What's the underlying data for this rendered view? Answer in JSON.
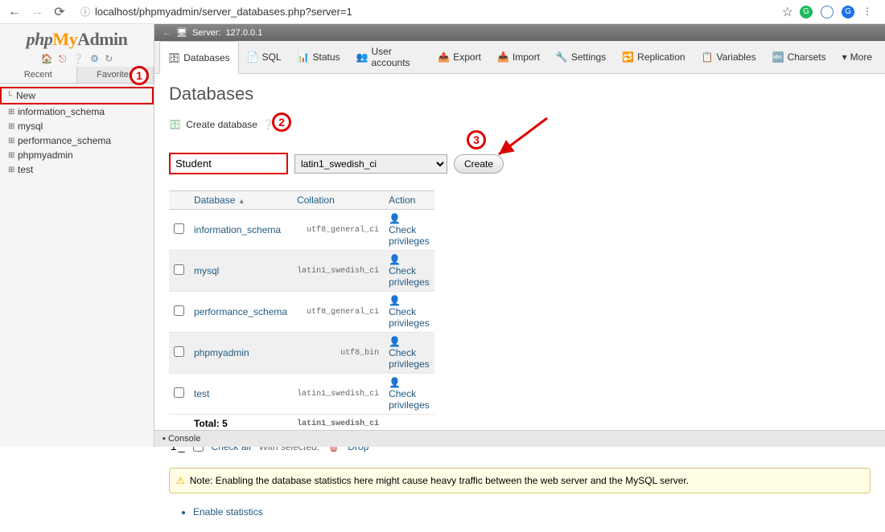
{
  "browser": {
    "url": "localhost/phpmyadmin/server_databases.php?server=1",
    "ext_colors": [
      "#1aba5e",
      "#4a7ec9",
      "#1a73e8"
    ]
  },
  "logo": {
    "part1": "php",
    "part2": "My",
    "part3": "Admin"
  },
  "side_tabs": {
    "recent": "Recent",
    "favorites": "Favorites"
  },
  "tree": {
    "new": "New",
    "items": [
      "information_schema",
      "mysql",
      "performance_schema",
      "phpmyadmin",
      "test"
    ]
  },
  "server_bar": {
    "label": "Server:",
    "name": "127.0.0.1"
  },
  "nav_tabs": [
    {
      "icon": "🗄",
      "label": "Databases"
    },
    {
      "icon": "📄",
      "label": "SQL"
    },
    {
      "icon": "📊",
      "label": "Status"
    },
    {
      "icon": "👥",
      "label": "User accounts"
    },
    {
      "icon": "📤",
      "label": "Export"
    },
    {
      "icon": "📥",
      "label": "Import"
    },
    {
      "icon": "🔧",
      "label": "Settings"
    },
    {
      "icon": "🔁",
      "label": "Replication"
    },
    {
      "icon": "📋",
      "label": "Variables"
    },
    {
      "icon": "🔤",
      "label": "Charsets"
    },
    {
      "icon": "▾",
      "label": "More"
    }
  ],
  "page": {
    "title": "Databases",
    "create_label": "Create database",
    "dbname_value": "Student",
    "collation_value": "latin1_swedish_ci",
    "create_btn": "Create"
  },
  "table": {
    "headers": {
      "db": "Database",
      "coll": "Collation",
      "action": "Action"
    },
    "rows": [
      {
        "name": "information_schema",
        "coll": "utf8_general_ci",
        "action": "Check privileges"
      },
      {
        "name": "mysql",
        "coll": "latin1_swedish_ci",
        "action": "Check privileges"
      },
      {
        "name": "performance_schema",
        "coll": "utf8_general_ci",
        "action": "Check privileges"
      },
      {
        "name": "phpmyadmin",
        "coll": "utf8_bin",
        "action": "Check privileges"
      },
      {
        "name": "test",
        "coll": "latin1_swedish_ci",
        "action": "Check privileges"
      }
    ],
    "total_label": "Total: 5",
    "total_coll": "latin1_swedish_ci"
  },
  "checkall": {
    "check_all": "Check all",
    "with_selected": "With selected:",
    "drop": "Drop"
  },
  "note": "Note: Enabling the database statistics here might cause heavy traffic between the web server and the MySQL server.",
  "enable_stats": "Enable statistics",
  "console": "Console",
  "annotations": {
    "a1": "1",
    "a2": "2",
    "a3": "3"
  }
}
